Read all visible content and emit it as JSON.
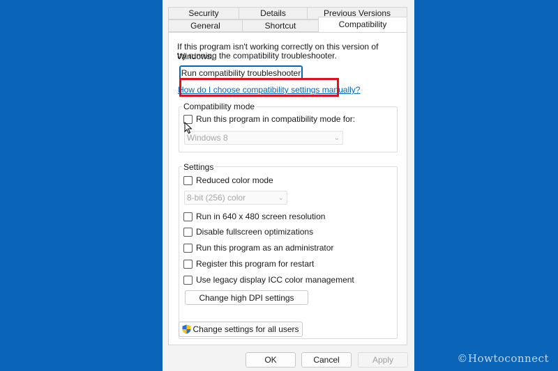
{
  "tabs": {
    "row1": [
      "Security",
      "Details",
      "Previous Versions"
    ],
    "row2": [
      "General",
      "Shortcut",
      "Compatibility"
    ],
    "active": "Compatibility"
  },
  "compat": {
    "intro_line1": "If this program isn't working correctly on this version of Windows,",
    "intro_line2": "try running the compatibility troubleshooter.",
    "troubleshooter_button": "Run compatibility troubleshooter",
    "help_link": "How do I choose compatibility settings manually?",
    "mode_group": "Compatibility mode",
    "mode_checkbox": "Run this program in compatibility mode for:",
    "mode_checked": false,
    "mode_select": "Windows 8"
  },
  "settings": {
    "group": "Settings",
    "reduced_color": "Reduced color mode",
    "color_select": "8-bit (256) color",
    "res_640": "Run in 640 x 480 screen resolution",
    "fullscreen": "Disable fullscreen optimizations",
    "admin": "Run this program as an administrator",
    "restart": "Register this program for restart",
    "icc": "Use legacy display ICC color management",
    "dpi_button": "Change high DPI settings"
  },
  "all_users_button": "Change settings for all users",
  "footer": {
    "ok": "OK",
    "cancel": "Cancel",
    "apply": "Apply"
  },
  "watermark": "©Howtoconnect",
  "colors": {
    "desktop": "#0a64b8",
    "link": "#0067c0",
    "highlight": "#e0101c"
  }
}
